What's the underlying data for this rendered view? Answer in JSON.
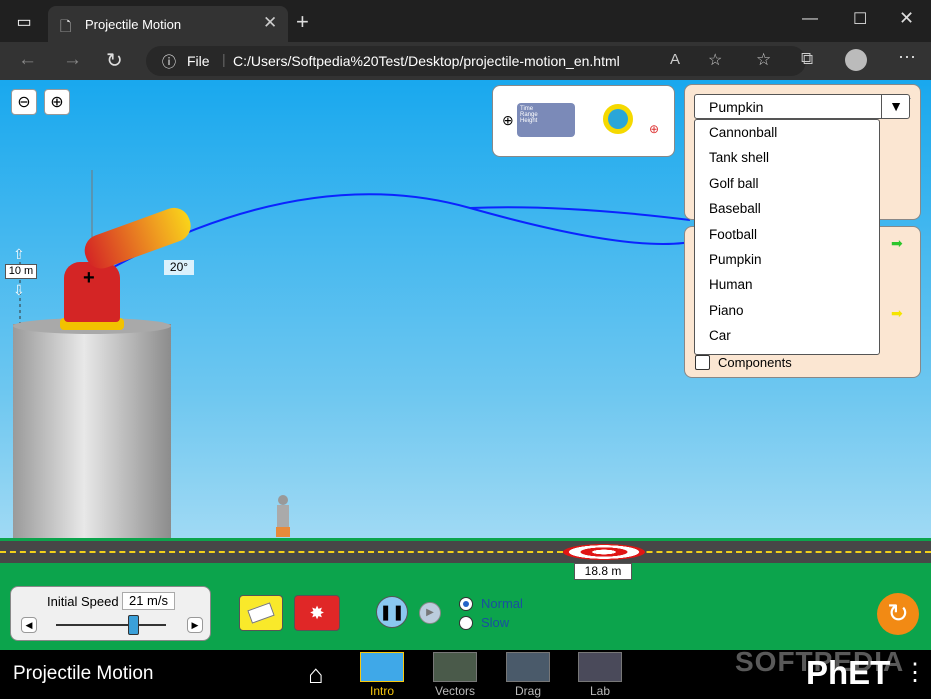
{
  "browser": {
    "tab_title": "Projectile Motion",
    "url_scheme": "File",
    "url": "C:/Users/Softpedia%20Test/Desktop/projectile-motion_en.html"
  },
  "sim": {
    "height_label": "10 m",
    "angle_label": "20°",
    "target_label": "18.8 m",
    "projectile_dropdown": {
      "selected": "Pumpkin",
      "options": [
        "Cannonball",
        "Tank shell",
        "Golf ball",
        "Baseball",
        "Football",
        "Pumpkin",
        "Human",
        "Piano",
        "Car"
      ]
    },
    "components_label": "Components",
    "tool_labels": {
      "time": "Time",
      "range": "Range",
      "height": "Height"
    },
    "initial_speed_label": "Initial Speed",
    "initial_speed_value": "21 m/s",
    "speed_normal": "Normal",
    "speed_slow": "Slow"
  },
  "footer": {
    "title": "Projectile Motion",
    "screens": [
      "Intro",
      "Vectors",
      "Drag",
      "Lab"
    ],
    "logo": "PhET",
    "watermark": "SOFTPEDIA"
  },
  "colors": {
    "accent": "#f9c80e",
    "sky": "#19a8ee",
    "ground": "#0ca44c"
  }
}
